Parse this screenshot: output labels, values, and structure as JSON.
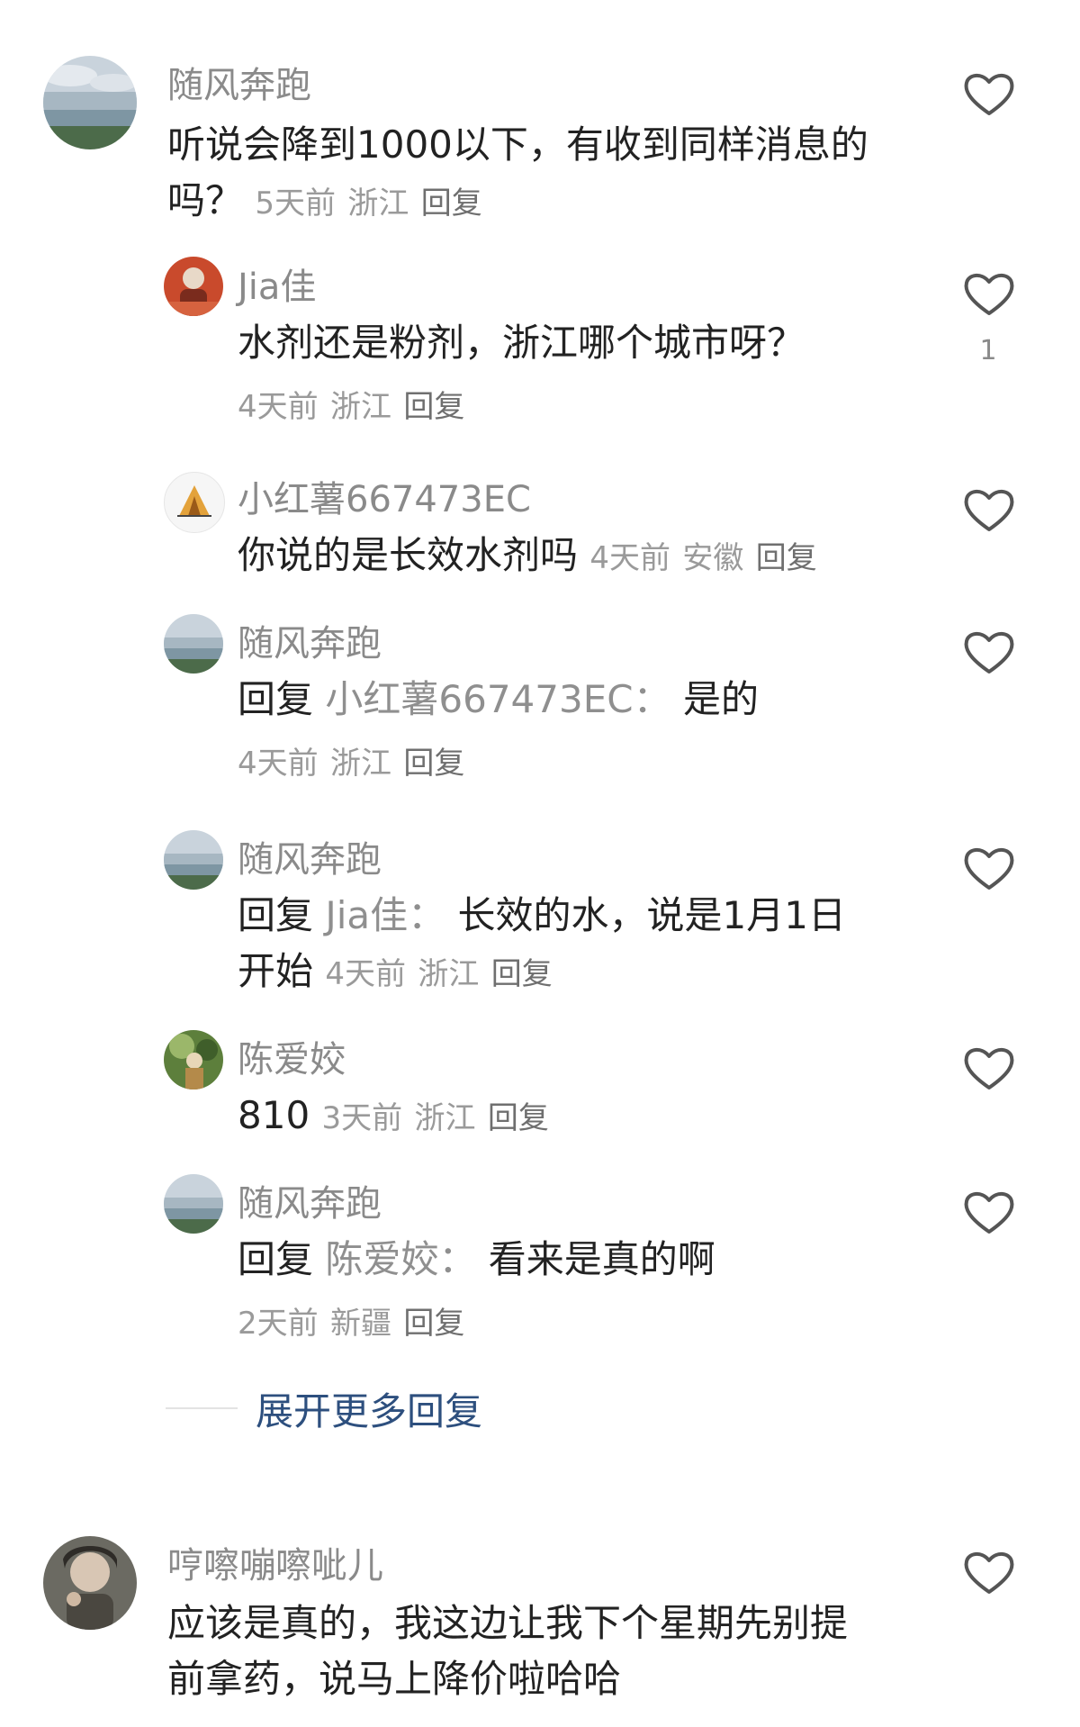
{
  "comments": [
    {
      "author": "随风奔跑",
      "text_line1": "听说会降到1000以下，有收到同样消息的",
      "text_line2": "吗？",
      "time": "5天前",
      "location": "浙江",
      "reply_label": "回复"
    },
    {
      "author": "Jia佳",
      "text": "水剂还是粉剂，浙江哪个城市呀？",
      "time": "4天前",
      "location": "浙江",
      "reply_label": "回复",
      "like_count": "1"
    },
    {
      "author": "小红薯667473EC",
      "text": "你说的是长效水剂吗",
      "time": "4天前",
      "location": "安徽",
      "reply_label": "回复"
    },
    {
      "author": "随风奔跑",
      "prefix": "回复",
      "target": "小红薯667473EC",
      "colon": "：",
      "text": "是的",
      "time": "4天前",
      "location": "浙江",
      "reply_label": "回复"
    },
    {
      "author": "随风奔跑",
      "prefix": "回复",
      "target": "Jia佳",
      "colon": "：",
      "text_line1": "长效的水，说是1月1日",
      "text_line2": "开始",
      "time": "4天前",
      "location": "浙江",
      "reply_label": "回复"
    },
    {
      "author": "陈爱姣",
      "text": "810",
      "time": "3天前",
      "location": "浙江",
      "reply_label": "回复"
    },
    {
      "author": "随风奔跑",
      "prefix": "回复",
      "target": "陈爱姣",
      "colon": "：",
      "text": "看来是真的啊",
      "time": "2天前",
      "location": "新疆",
      "reply_label": "回复"
    },
    {
      "author": "哼嚓嘣嚓呲儿",
      "text_line1": "应该是真的，我这边让我下个星期先别提",
      "text_line2": "前拿药，说马上降价啦哈哈"
    }
  ],
  "expand_more_label": "展开更多回复",
  "icons": {
    "like": "heart-outline-icon"
  },
  "colors": {
    "link_blue": "#2d4f7e",
    "meta_gray": "#9a9a9a"
  }
}
